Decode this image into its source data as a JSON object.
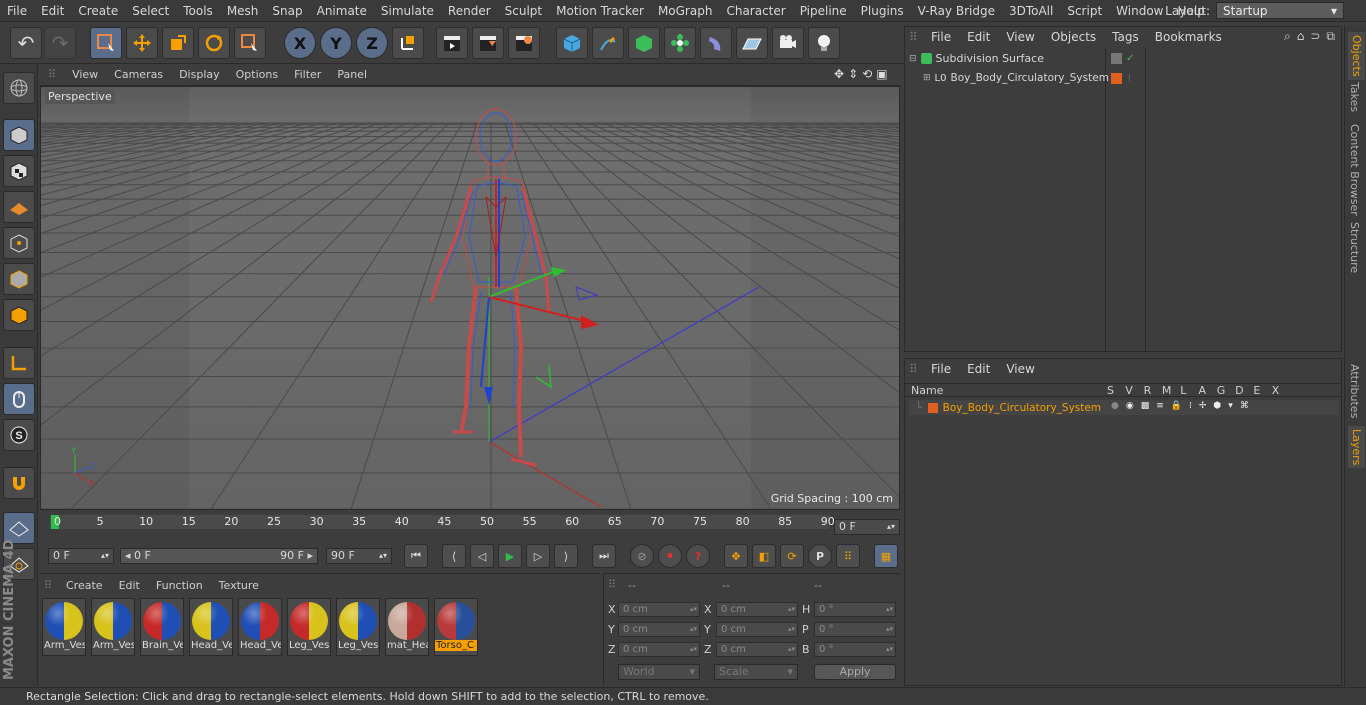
{
  "menu": [
    "File",
    "Edit",
    "Create",
    "Select",
    "Tools",
    "Mesh",
    "Snap",
    "Animate",
    "Simulate",
    "Render",
    "Sculpt",
    "Motion Tracker",
    "MoGraph",
    "Character",
    "Pipeline",
    "Plugins",
    "V-Ray Bridge",
    "3DToAll",
    "Script",
    "Window",
    "Help"
  ],
  "layout": {
    "label": "Layout:",
    "value": "Startup"
  },
  "viewport": {
    "menu": [
      "View",
      "Cameras",
      "Display",
      "Options",
      "Filter",
      "Panel"
    ],
    "camera_label": "Perspective",
    "grid_spacing": "Grid Spacing : 100 cm"
  },
  "timeline": {
    "ticks": [
      "0",
      "5",
      "10",
      "15",
      "20",
      "25",
      "30",
      "35",
      "40",
      "45",
      "50",
      "55",
      "60",
      "65",
      "70",
      "75",
      "80",
      "85",
      "90"
    ],
    "current_frame": "0 F"
  },
  "playback": {
    "start": "0 F",
    "range_start": "0 F",
    "range_end": "90 F",
    "end": "90 F"
  },
  "materials": {
    "menu": [
      "Create",
      "Edit",
      "Function",
      "Texture"
    ],
    "items": [
      {
        "name": "Arm_Ves",
        "c1": "#1f4fb5",
        "c2": "#d8c21c"
      },
      {
        "name": "Arm_Ves",
        "c1": "#d8c21c",
        "c2": "#1f4fb5"
      },
      {
        "name": "Brain_Ve",
        "c1": "#c52a2a",
        "c2": "#1f4fb5"
      },
      {
        "name": "Head_Ve",
        "c1": "#d8c21c",
        "c2": "#1f4fb5"
      },
      {
        "name": "Head_Ve",
        "c1": "#1f4fb5",
        "c2": "#c52a2a"
      },
      {
        "name": "Leg_Ves",
        "c1": "#c52a2a",
        "c2": "#d8c21c"
      },
      {
        "name": "Leg_Ves",
        "c1": "#d8c21c",
        "c2": "#1f4fb5"
      },
      {
        "name": "mat_Hea",
        "c1": "#c8a89a",
        "c2": "#b03030"
      },
      {
        "name": "Torso_C",
        "c1": "#b83a3a",
        "c2": "#2a4f9a"
      }
    ]
  },
  "coords": {
    "headers": [
      "--",
      "--",
      "--"
    ],
    "rows": [
      {
        "l1": "X",
        "v1": "0 cm",
        "l2": "X",
        "v2": "0 cm",
        "l3": "H",
        "v3": "0 °"
      },
      {
        "l1": "Y",
        "v1": "0 cm",
        "l2": "Y",
        "v2": "0 cm",
        "l3": "P",
        "v3": "0 °"
      },
      {
        "l1": "Z",
        "v1": "0 cm",
        "l2": "Z",
        "v2": "0 cm",
        "l3": "B",
        "v3": "0 °"
      }
    ],
    "mode1": "World",
    "mode2": "Scale",
    "apply": "Apply"
  },
  "objects": {
    "menu": [
      "File",
      "Edit",
      "View",
      "Objects",
      "Tags",
      "Bookmarks"
    ],
    "items": [
      "Subdivision Surface",
      "Boy_Body_Circulatory_System"
    ]
  },
  "layers": {
    "menu": [
      "File",
      "Edit",
      "View"
    ],
    "columns": [
      "Name",
      "S",
      "V",
      "R",
      "M",
      "L",
      "A",
      "G",
      "D",
      "E",
      "X"
    ],
    "item": "Boy_Body_Circulatory_System"
  },
  "right_tabs": [
    "Objects",
    "Takes",
    "Content Browser",
    "Structure",
    "Attributes",
    "Layers"
  ],
  "brand": "MAXON CINEMA 4D",
  "status": "Rectangle Selection: Click and drag to rectangle-select elements. Hold down SHIFT to add to the selection, CTRL to remove.",
  "colors": {
    "accent": "#f5a000",
    "selected": "#5a6d8a",
    "bg": "#3d3d3d"
  }
}
